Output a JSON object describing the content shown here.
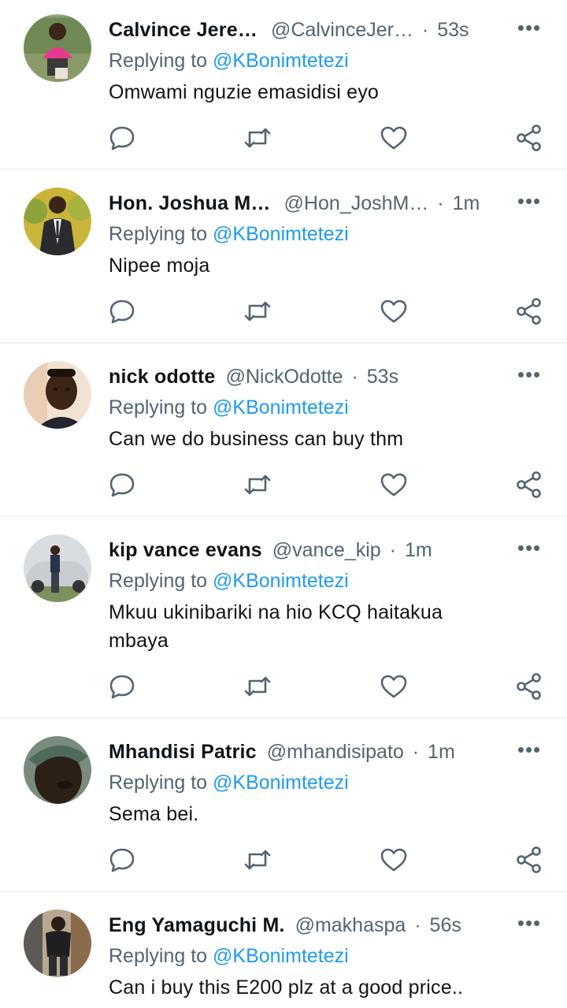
{
  "colors": {
    "accent": "#1d9bf0",
    "secondary_text": "#536471",
    "divider": "#eff3f4"
  },
  "more_label": "•••",
  "replying_label": "Replying to",
  "dot": "·",
  "tweets": [
    {
      "name": "Calvince Jere…",
      "handle": "@CalvinceJer…",
      "time": "53s",
      "replying_to": "@KBonimtetezi",
      "text": "Omwami nguzie emasidisi eyo",
      "avatar_icon": "person-avatar-pink-shirt"
    },
    {
      "name": "Hon. Joshua M…",
      "handle": "@Hon_JoshM…",
      "time": "1m",
      "replying_to": "@KBonimtetezi",
      "text": "Nipee moja",
      "avatar_icon": "person-avatar-suit"
    },
    {
      "name": "nick odotte",
      "handle": "@NickOdotte",
      "time": "53s",
      "replying_to": "@KBonimtetezi",
      "text": "Can we do business can buy thm",
      "avatar_icon": "person-avatar-selfie"
    },
    {
      "name": "kip vance evans",
      "handle": "@vance_kip",
      "time": "1m",
      "replying_to": "@KBonimtetezi",
      "text": "Mkuu ukinibariki na hio KCQ haitakua mbaya",
      "avatar_icon": "person-avatar-car"
    },
    {
      "name": "Mhandisi Patric",
      "handle": "@mhandisipato",
      "time": "1m",
      "replying_to": "@KBonimtetezi",
      "text": "Sema bei.",
      "avatar_icon": "person-avatar-cap"
    },
    {
      "name": "Eng Yamaguchi M.",
      "handle": "@makhaspa",
      "time": "56s",
      "replying_to": "@KBonimtetezi",
      "text": "Can i buy this E200 plz at a good price..",
      "avatar_icon": "person-avatar-street"
    }
  ]
}
